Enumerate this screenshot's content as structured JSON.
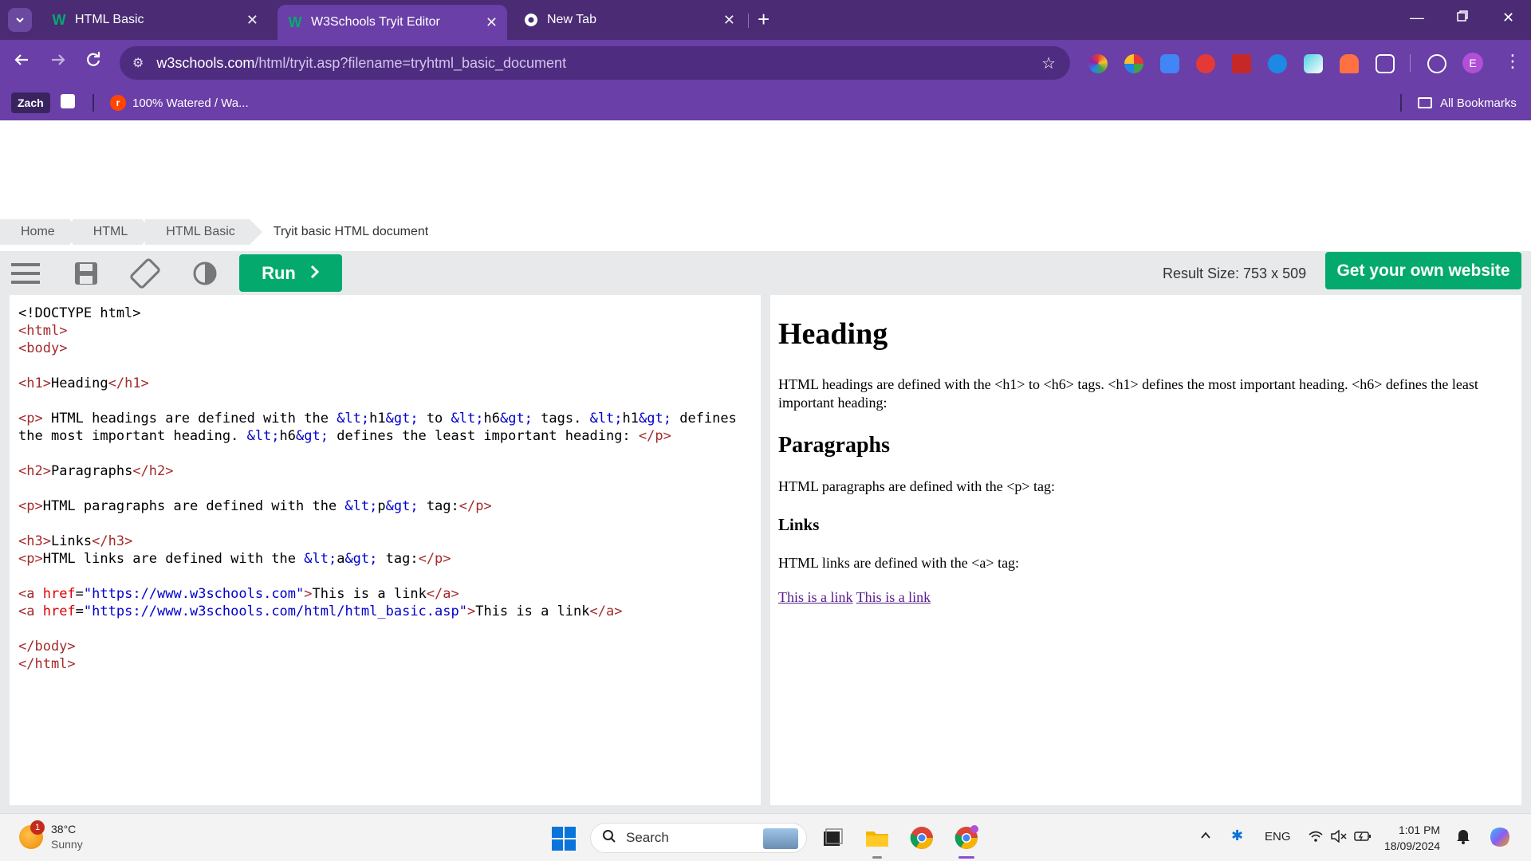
{
  "browser": {
    "tabs": [
      {
        "title": "HTML Basic",
        "favicon": "w3schools-icon",
        "active": false
      },
      {
        "title": "W3Schools Tryit Editor",
        "favicon": "w3schools-icon",
        "active": true
      },
      {
        "title": "New Tab",
        "favicon": "chrome-icon",
        "active": false
      }
    ],
    "address": {
      "host": "w3schools.com",
      "path": "/html/tryit.asp?filename=tryhtml_basic_document"
    },
    "profile_initial": "E",
    "bookmarks": {
      "profile_label": "Zach",
      "items": [
        {
          "label": "100% Watered / Wa...",
          "icon": "reddit-icon"
        }
      ],
      "all_label": "All Bookmarks"
    }
  },
  "breadcrumb": [
    "Home",
    "HTML",
    "HTML Basic",
    "Tryit basic HTML document"
  ],
  "toolbar": {
    "run_label": "Run",
    "result_size": "Result Size: 753 x 509",
    "own_website": "Get your own website"
  },
  "code_lines": [
    [
      {
        "t": "txt",
        "v": "<!DOCTYPE html>"
      }
    ],
    [
      {
        "t": "tag",
        "v": "<"
      },
      {
        "t": "nm",
        "v": "html"
      },
      {
        "t": "tag",
        "v": ">"
      }
    ],
    [
      {
        "t": "tag",
        "v": "<"
      },
      {
        "t": "nm",
        "v": "body"
      },
      {
        "t": "tag",
        "v": ">"
      }
    ],
    [],
    [
      {
        "t": "tag",
        "v": "<h1>"
      },
      {
        "t": "txt",
        "v": "Heading"
      },
      {
        "t": "tag",
        "v": "</h1>"
      }
    ],
    [],
    [
      {
        "t": "tag",
        "v": "<p>"
      },
      {
        "t": "txt",
        "v": " HTML headings are defined with the "
      },
      {
        "t": "ent",
        "v": "&lt;"
      },
      {
        "t": "txt",
        "v": "h1"
      },
      {
        "t": "ent",
        "v": "&gt;"
      },
      {
        "t": "txt",
        "v": " to "
      },
      {
        "t": "ent",
        "v": "&lt;"
      },
      {
        "t": "txt",
        "v": "h6"
      },
      {
        "t": "ent",
        "v": "&gt;"
      },
      {
        "t": "txt",
        "v": " tags. "
      },
      {
        "t": "ent",
        "v": "&lt;"
      },
      {
        "t": "txt",
        "v": "h1"
      },
      {
        "t": "ent",
        "v": "&gt;"
      },
      {
        "t": "txt",
        "v": " defines"
      }
    ],
    [
      {
        "t": "txt",
        "v": "the most important heading. "
      },
      {
        "t": "ent",
        "v": "&lt;"
      },
      {
        "t": "txt",
        "v": "h6"
      },
      {
        "t": "ent",
        "v": "&gt;"
      },
      {
        "t": "txt",
        "v": " defines the least important heading: "
      },
      {
        "t": "tag",
        "v": "</p>"
      }
    ],
    [],
    [
      {
        "t": "tag",
        "v": "<h2>"
      },
      {
        "t": "txt",
        "v": "Paragraphs"
      },
      {
        "t": "tag",
        "v": "</h2>"
      }
    ],
    [],
    [
      {
        "t": "tag",
        "v": "<p>"
      },
      {
        "t": "txt",
        "v": "HTML paragraphs are defined with the "
      },
      {
        "t": "ent",
        "v": "&lt;"
      },
      {
        "t": "txt",
        "v": "p"
      },
      {
        "t": "ent",
        "v": "&gt;"
      },
      {
        "t": "txt",
        "v": " tag:"
      },
      {
        "t": "tag",
        "v": "</p>"
      }
    ],
    [],
    [
      {
        "t": "tag",
        "v": "<h3>"
      },
      {
        "t": "txt",
        "v": "Links"
      },
      {
        "t": "tag",
        "v": "</h3>"
      }
    ],
    [
      {
        "t": "tag",
        "v": "<p>"
      },
      {
        "t": "txt",
        "v": "HTML links are defined with the "
      },
      {
        "t": "ent",
        "v": "&lt;"
      },
      {
        "t": "txt",
        "v": "a"
      },
      {
        "t": "ent",
        "v": "&gt;"
      },
      {
        "t": "txt",
        "v": " tag:"
      },
      {
        "t": "tag",
        "v": "</p>"
      }
    ],
    [],
    [
      {
        "t": "tag",
        "v": "<a "
      },
      {
        "t": "attr",
        "v": "href"
      },
      {
        "t": "txt",
        "v": "="
      },
      {
        "t": "val",
        "v": "\"https://www.w3schools.com\""
      },
      {
        "t": "tag",
        "v": ">"
      },
      {
        "t": "txt",
        "v": "This is a link"
      },
      {
        "t": "tag",
        "v": "</a>"
      }
    ],
    [
      {
        "t": "tag",
        "v": "<a "
      },
      {
        "t": "attr",
        "v": "href"
      },
      {
        "t": "txt",
        "v": "="
      },
      {
        "t": "val",
        "v": "\"https://www.w3schools.com/html/html_basic.asp\""
      },
      {
        "t": "tag",
        "v": ">"
      },
      {
        "t": "txt",
        "v": "This is a link"
      },
      {
        "t": "tag",
        "v": "</a>"
      }
    ],
    [],
    [
      {
        "t": "tag",
        "v": "</body>"
      }
    ],
    [
      {
        "t": "tag",
        "v": "</html>"
      }
    ]
  ],
  "result": {
    "h1": "Heading",
    "p1": "HTML headings are defined with the <h1> to <h6> tags. <h1> defines the most important heading. <h6> defines the least important heading:",
    "h2": "Paragraphs",
    "p2": "HTML paragraphs are defined with the <p> tag:",
    "h3": "Links",
    "p3": "HTML links are defined with the <a> tag:",
    "link1": "This is a link",
    "link2": "This is a link"
  },
  "taskbar": {
    "weather_temp": "38°C",
    "weather_cond": "Sunny",
    "weather_badge": "1",
    "search_placeholder": "Search",
    "lang": "ENG",
    "time": "1:01 PM",
    "date": "18/09/2024"
  },
  "colors": {
    "accent": "#04aa6d",
    "chrome_dark": "#4a2b74",
    "chrome": "#6a3fa7"
  }
}
